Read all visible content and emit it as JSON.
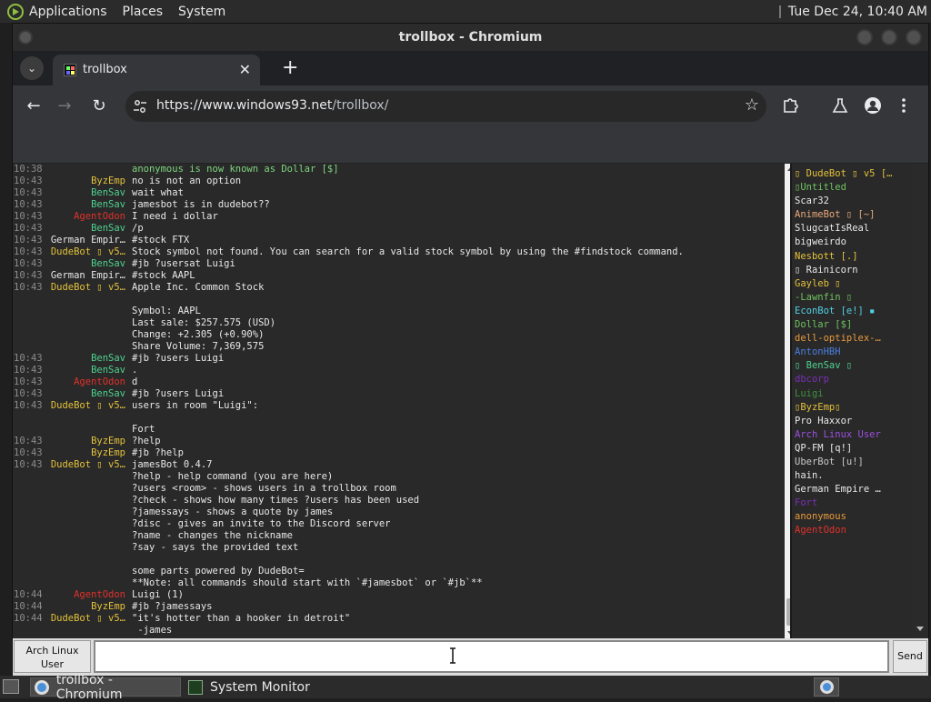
{
  "top_panel": {
    "menus": [
      "Applications",
      "Places",
      "System"
    ],
    "clock": "Tue Dec 24, 10:40 AM"
  },
  "window": {
    "title": "trollbox - Chromium"
  },
  "browser": {
    "tab_title": "trollbox",
    "url_domain": "https://www.windows93.net",
    "url_path": "/trollbox/"
  },
  "chat": {
    "messages": [
      {
        "time": "10:38",
        "nick": "",
        "nick_color": "#9a9a9a",
        "text": "anonymous is now known as Dollar [$]",
        "text_color": "#7fd67f"
      },
      {
        "time": "10:43",
        "nick": "ByzEmp",
        "nick_color": "#e3c13b",
        "text": "no is not an option",
        "text_color": "#e8e8e8"
      },
      {
        "time": "10:43",
        "nick": "BenSav",
        "nick_color": "#4fd18f",
        "text": "wait what",
        "text_color": "#e8e8e8"
      },
      {
        "time": "10:43",
        "nick": "BenSav",
        "nick_color": "#4fd18f",
        "text": "jamesbot is in dudebot??",
        "text_color": "#e8e8e8"
      },
      {
        "time": "10:43",
        "nick": "AgentOdon",
        "nick_color": "#e0312b",
        "text": "I need i dollar",
        "text_color": "#e8e8e8"
      },
      {
        "time": "10:43",
        "nick": "BenSav",
        "nick_color": "#4fd18f",
        "text": "/p",
        "text_color": "#e8e8e8"
      },
      {
        "time": "10:43",
        "nick": "German Empir…",
        "nick_color": "#e8e8e8",
        "text": "#stock FTX",
        "text_color": "#e8e8e8"
      },
      {
        "time": "10:43",
        "nick": "DudeBot ▯ v5…",
        "nick_color": "#e3c13b",
        "text": "Stock symbol not found. You can search for a valid stock symbol by using the #findstock command.",
        "text_color": "#e8e8e8"
      },
      {
        "time": "10:43",
        "nick": "BenSav",
        "nick_color": "#4fd18f",
        "text": "#jb ?usersat Luigi",
        "text_color": "#e8e8e8"
      },
      {
        "time": "10:43",
        "nick": "German Empir…",
        "nick_color": "#e8e8e8",
        "text": "#stock AAPL",
        "text_color": "#e8e8e8"
      },
      {
        "time": "10:43",
        "nick": "DudeBot ▯ v5…",
        "nick_color": "#e3c13b",
        "text": "Apple Inc. Common Stock",
        "text_color": "#e8e8e8"
      },
      {
        "time": "",
        "nick": "",
        "nick_color": "#e8e8e8",
        "text": "",
        "text_color": "#e8e8e8"
      },
      {
        "time": "",
        "nick": "",
        "nick_color": "#e8e8e8",
        "text": "Symbol: AAPL",
        "text_color": "#e8e8e8"
      },
      {
        "time": "",
        "nick": "",
        "nick_color": "#e8e8e8",
        "text": "Last sale: $257.575 (USD)",
        "text_color": "#e8e8e8"
      },
      {
        "time": "",
        "nick": "",
        "nick_color": "#e8e8e8",
        "text": "Change: +2.305 (+0.90%)",
        "text_color": "#e8e8e8"
      },
      {
        "time": "",
        "nick": "",
        "nick_color": "#e8e8e8",
        "text": "Share Volume: 7,369,575",
        "text_color": "#e8e8e8"
      },
      {
        "time": "10:43",
        "nick": "BenSav",
        "nick_color": "#4fd18f",
        "text": "#jb ?users Luigi",
        "text_color": "#e8e8e8"
      },
      {
        "time": "10:43",
        "nick": "BenSav",
        "nick_color": "#4fd18f",
        "text": ".",
        "text_color": "#e8e8e8"
      },
      {
        "time": "10:43",
        "nick": "AgentOdon",
        "nick_color": "#e0312b",
        "text": "d",
        "text_color": "#e8e8e8"
      },
      {
        "time": "10:43",
        "nick": "BenSav",
        "nick_color": "#4fd18f",
        "text": "#jb ?users Luigi",
        "text_color": "#e8e8e8"
      },
      {
        "time": "10:43",
        "nick": "DudeBot ▯ v5…",
        "nick_color": "#e3c13b",
        "text": "users in room \"Luigi\":",
        "text_color": "#e8e8e8"
      },
      {
        "time": "",
        "nick": "",
        "nick_color": "#e8e8e8",
        "text": "",
        "text_color": "#e8e8e8"
      },
      {
        "time": "",
        "nick": "",
        "nick_color": "#e8e8e8",
        "text": "Fort",
        "text_color": "#e8e8e8"
      },
      {
        "time": "10:43",
        "nick": "ByzEmp",
        "nick_color": "#e3c13b",
        "text": "?help",
        "text_color": "#e8e8e8"
      },
      {
        "time": "10:43",
        "nick": "ByzEmp",
        "nick_color": "#e3c13b",
        "text": "#jb ?help",
        "text_color": "#e8e8e8"
      },
      {
        "time": "10:43",
        "nick": "DudeBot ▯ v5…",
        "nick_color": "#e3c13b",
        "text": "jamesBot 0.4.7",
        "text_color": "#e8e8e8"
      },
      {
        "time": "",
        "nick": "",
        "nick_color": "#e8e8e8",
        "text": "?help - help command (you are here)",
        "text_color": "#e8e8e8"
      },
      {
        "time": "",
        "nick": "",
        "nick_color": "#e8e8e8",
        "text": "?users <room> - shows users in a trollbox room",
        "text_color": "#e8e8e8"
      },
      {
        "time": "",
        "nick": "",
        "nick_color": "#e8e8e8",
        "text": "?check - shows how many times ?users has been used",
        "text_color": "#e8e8e8"
      },
      {
        "time": "",
        "nick": "",
        "nick_color": "#e8e8e8",
        "text": "?jamessays - shows a quote by james",
        "text_color": "#e8e8e8"
      },
      {
        "time": "",
        "nick": "",
        "nick_color": "#e8e8e8",
        "text": "?disc - gives an invite to the Discord server",
        "text_color": "#e8e8e8"
      },
      {
        "time": "",
        "nick": "",
        "nick_color": "#e8e8e8",
        "text": "?name - changes the nickname",
        "text_color": "#e8e8e8"
      },
      {
        "time": "",
        "nick": "",
        "nick_color": "#e8e8e8",
        "text": "?say - says the provided text",
        "text_color": "#e8e8e8"
      },
      {
        "time": "",
        "nick": "",
        "nick_color": "#e8e8e8",
        "text": "",
        "text_color": "#e8e8e8"
      },
      {
        "time": "",
        "nick": "",
        "nick_color": "#e8e8e8",
        "text": "some parts powered by DudeBot=",
        "text_color": "#e8e8e8"
      },
      {
        "time": "",
        "nick": "",
        "nick_color": "#e8e8e8",
        "text": "**Note: all commands should start with `#jamesbot` or `#jb`**",
        "text_color": "#e8e8e8"
      },
      {
        "time": "10:44",
        "nick": "AgentOdon",
        "nick_color": "#e0312b",
        "text": "Luigi (1)",
        "text_color": "#e8e8e8"
      },
      {
        "time": "10:44",
        "nick": "ByzEmp",
        "nick_color": "#e3c13b",
        "text": "#jb ?jamessays",
        "text_color": "#e8e8e8"
      },
      {
        "time": "10:44",
        "nick": "DudeBot ▯ v5…",
        "nick_color": "#e3c13b",
        "text": "\"it's hotter than a hooker in detroit\"",
        "text_color": "#e8e8e8"
      },
      {
        "time": "",
        "nick": "",
        "nick_color": "#e8e8e8",
        "text": " -james",
        "text_color": "#e8e8e8"
      }
    ]
  },
  "users": [
    {
      "name": "▯ DudeBot ▯ v5 […",
      "color": "#e3c13b"
    },
    {
      "name": "▯Untitled",
      "color": "#6fc25f"
    },
    {
      "name": "Scar32",
      "color": "#e8e8e8"
    },
    {
      "name": "AnimeBot ▯ [~]",
      "color": "#e8a87a"
    },
    {
      "name": "SlugcatIsReal",
      "color": "#e8e8e8"
    },
    {
      "name": "bigweirdo",
      "color": "#e8e8e8"
    },
    {
      "name": "Nesbott [.]",
      "color": "#e3c13b"
    },
    {
      "name": "▯ Rainicorn",
      "color": "#e8e8e8"
    },
    {
      "name": "Gayleb ▯",
      "color": "#e3c13b"
    },
    {
      "name": "-Lawnfin ▯",
      "color": "#6fc25f"
    },
    {
      "name": "EconBot [e!] ▪",
      "color": "#4fd1e3"
    },
    {
      "name": "Dollar [$]",
      "color": "#6fc25f"
    },
    {
      "name": "dell-optiplex-…",
      "color": "#e89a3b"
    },
    {
      "name": "AntonHBH",
      "color": "#4a7fe0"
    },
    {
      "name": "▯ BenSav ▯",
      "color": "#4fd18f"
    },
    {
      "name": "dbcorp",
      "color": "#7a2fb5"
    },
    {
      "name": "Luigi",
      "color": "#3f8f3f"
    },
    {
      "name": "▯ByzEmp▯",
      "color": "#e3c13b"
    },
    {
      "name": "Pro Haxxor",
      "color": "#e8e8e8"
    },
    {
      "name": "Arch Linux User",
      "color": "#9b4fe0"
    },
    {
      "name": "QP-FM [q!]",
      "color": "#e8e8e8"
    },
    {
      "name": "UberBot [u!]",
      "color": "#c8c8c8"
    },
    {
      "name": "hain.",
      "color": "#e8e8e8"
    },
    {
      "name": "German Empire …",
      "color": "#e8e8e8"
    },
    {
      "name": "Fort",
      "color": "#7a2fb5"
    },
    {
      "name": "anonymous",
      "color": "#e89a3b"
    },
    {
      "name": "AgentOdon",
      "color": "#e0312b"
    }
  ],
  "input_bar": {
    "user_label_1": "Arch Linux",
    "user_label_2": "User",
    "message_value": "",
    "send_label": "Send"
  },
  "taskbar": {
    "tasks": [
      "trollbox - Chromium",
      "System Monitor"
    ]
  }
}
